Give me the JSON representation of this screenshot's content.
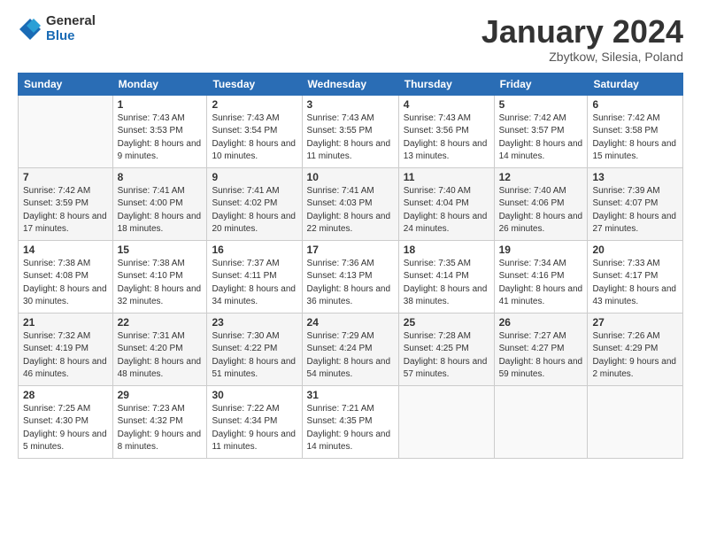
{
  "header": {
    "logo_general": "General",
    "logo_blue": "Blue",
    "title": "January 2024",
    "location": "Zbytkow, Silesia, Poland"
  },
  "weekdays": [
    "Sunday",
    "Monday",
    "Tuesday",
    "Wednesday",
    "Thursday",
    "Friday",
    "Saturday"
  ],
  "weeks": [
    [
      {
        "day": "",
        "info": ""
      },
      {
        "day": "1",
        "info": "Sunrise: 7:43 AM\nSunset: 3:53 PM\nDaylight: 8 hours\nand 9 minutes."
      },
      {
        "day": "2",
        "info": "Sunrise: 7:43 AM\nSunset: 3:54 PM\nDaylight: 8 hours\nand 10 minutes."
      },
      {
        "day": "3",
        "info": "Sunrise: 7:43 AM\nSunset: 3:55 PM\nDaylight: 8 hours\nand 11 minutes."
      },
      {
        "day": "4",
        "info": "Sunrise: 7:43 AM\nSunset: 3:56 PM\nDaylight: 8 hours\nand 13 minutes."
      },
      {
        "day": "5",
        "info": "Sunrise: 7:42 AM\nSunset: 3:57 PM\nDaylight: 8 hours\nand 14 minutes."
      },
      {
        "day": "6",
        "info": "Sunrise: 7:42 AM\nSunset: 3:58 PM\nDaylight: 8 hours\nand 15 minutes."
      }
    ],
    [
      {
        "day": "7",
        "info": "Sunrise: 7:42 AM\nSunset: 3:59 PM\nDaylight: 8 hours\nand 17 minutes."
      },
      {
        "day": "8",
        "info": "Sunrise: 7:41 AM\nSunset: 4:00 PM\nDaylight: 8 hours\nand 18 minutes."
      },
      {
        "day": "9",
        "info": "Sunrise: 7:41 AM\nSunset: 4:02 PM\nDaylight: 8 hours\nand 20 minutes."
      },
      {
        "day": "10",
        "info": "Sunrise: 7:41 AM\nSunset: 4:03 PM\nDaylight: 8 hours\nand 22 minutes."
      },
      {
        "day": "11",
        "info": "Sunrise: 7:40 AM\nSunset: 4:04 PM\nDaylight: 8 hours\nand 24 minutes."
      },
      {
        "day": "12",
        "info": "Sunrise: 7:40 AM\nSunset: 4:06 PM\nDaylight: 8 hours\nand 26 minutes."
      },
      {
        "day": "13",
        "info": "Sunrise: 7:39 AM\nSunset: 4:07 PM\nDaylight: 8 hours\nand 27 minutes."
      }
    ],
    [
      {
        "day": "14",
        "info": "Sunrise: 7:38 AM\nSunset: 4:08 PM\nDaylight: 8 hours\nand 30 minutes."
      },
      {
        "day": "15",
        "info": "Sunrise: 7:38 AM\nSunset: 4:10 PM\nDaylight: 8 hours\nand 32 minutes."
      },
      {
        "day": "16",
        "info": "Sunrise: 7:37 AM\nSunset: 4:11 PM\nDaylight: 8 hours\nand 34 minutes."
      },
      {
        "day": "17",
        "info": "Sunrise: 7:36 AM\nSunset: 4:13 PM\nDaylight: 8 hours\nand 36 minutes."
      },
      {
        "day": "18",
        "info": "Sunrise: 7:35 AM\nSunset: 4:14 PM\nDaylight: 8 hours\nand 38 minutes."
      },
      {
        "day": "19",
        "info": "Sunrise: 7:34 AM\nSunset: 4:16 PM\nDaylight: 8 hours\nand 41 minutes."
      },
      {
        "day": "20",
        "info": "Sunrise: 7:33 AM\nSunset: 4:17 PM\nDaylight: 8 hours\nand 43 minutes."
      }
    ],
    [
      {
        "day": "21",
        "info": "Sunrise: 7:32 AM\nSunset: 4:19 PM\nDaylight: 8 hours\nand 46 minutes."
      },
      {
        "day": "22",
        "info": "Sunrise: 7:31 AM\nSunset: 4:20 PM\nDaylight: 8 hours\nand 48 minutes."
      },
      {
        "day": "23",
        "info": "Sunrise: 7:30 AM\nSunset: 4:22 PM\nDaylight: 8 hours\nand 51 minutes."
      },
      {
        "day": "24",
        "info": "Sunrise: 7:29 AM\nSunset: 4:24 PM\nDaylight: 8 hours\nand 54 minutes."
      },
      {
        "day": "25",
        "info": "Sunrise: 7:28 AM\nSunset: 4:25 PM\nDaylight: 8 hours\nand 57 minutes."
      },
      {
        "day": "26",
        "info": "Sunrise: 7:27 AM\nSunset: 4:27 PM\nDaylight: 8 hours\nand 59 minutes."
      },
      {
        "day": "27",
        "info": "Sunrise: 7:26 AM\nSunset: 4:29 PM\nDaylight: 9 hours\nand 2 minutes."
      }
    ],
    [
      {
        "day": "28",
        "info": "Sunrise: 7:25 AM\nSunset: 4:30 PM\nDaylight: 9 hours\nand 5 minutes."
      },
      {
        "day": "29",
        "info": "Sunrise: 7:23 AM\nSunset: 4:32 PM\nDaylight: 9 hours\nand 8 minutes."
      },
      {
        "day": "30",
        "info": "Sunrise: 7:22 AM\nSunset: 4:34 PM\nDaylight: 9 hours\nand 11 minutes."
      },
      {
        "day": "31",
        "info": "Sunrise: 7:21 AM\nSunset: 4:35 PM\nDaylight: 9 hours\nand 14 minutes."
      },
      {
        "day": "",
        "info": ""
      },
      {
        "day": "",
        "info": ""
      },
      {
        "day": "",
        "info": ""
      }
    ]
  ]
}
